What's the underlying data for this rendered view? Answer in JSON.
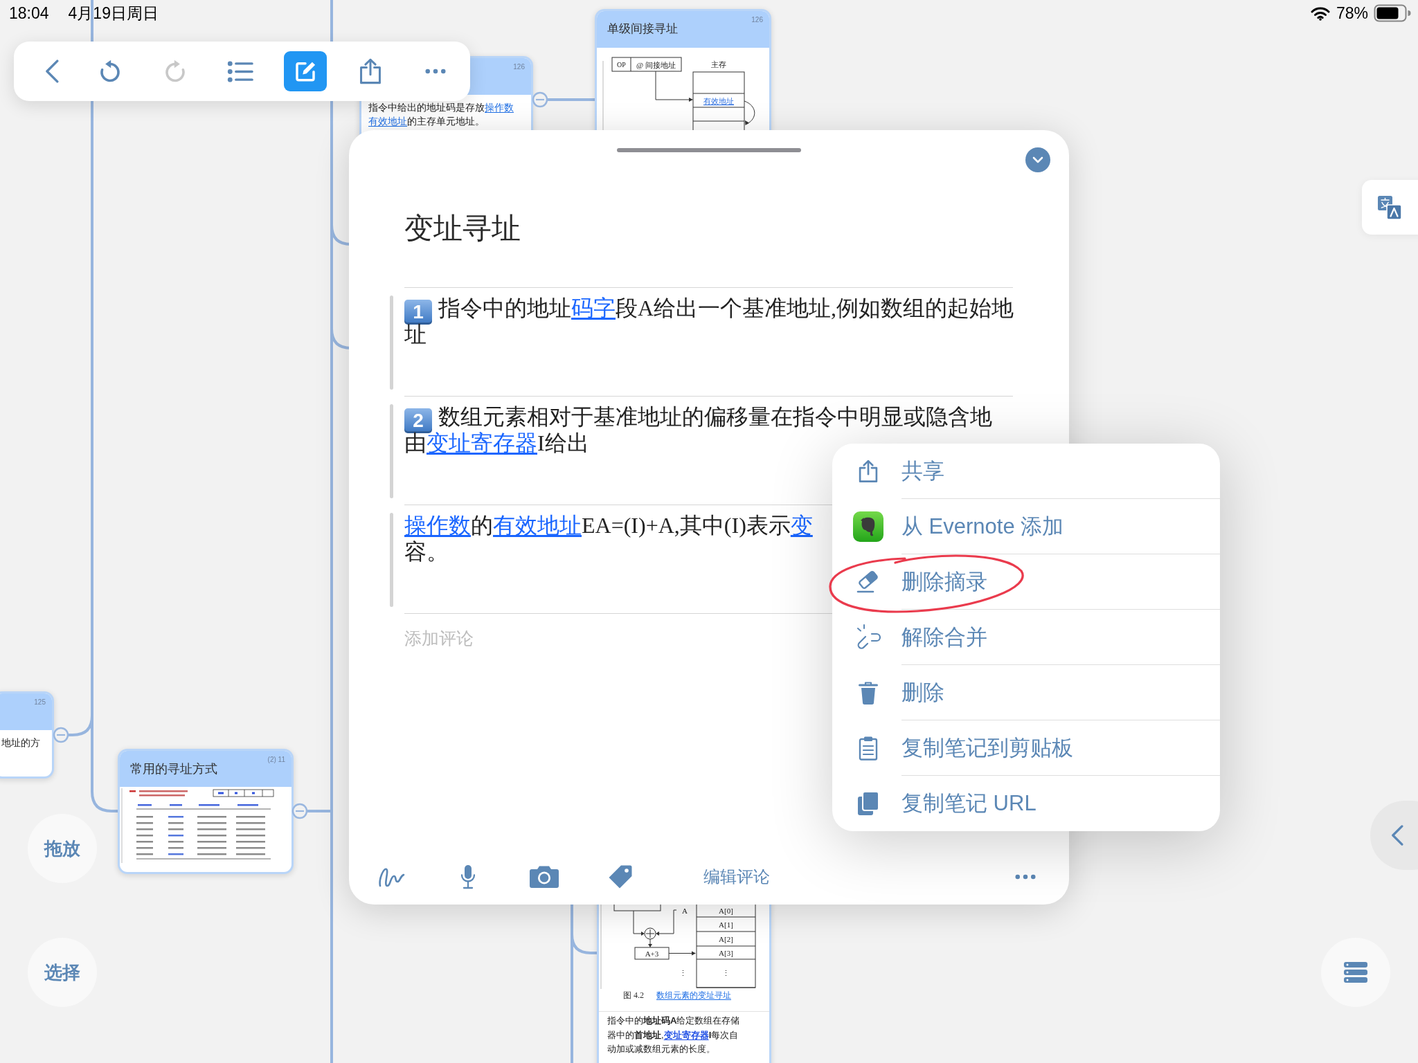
{
  "status_bar": {
    "time": "18:04",
    "date": "4月19日周日",
    "battery": "78%"
  },
  "toolbar": {
    "buttons": [
      {
        "kind": "back",
        "active": false,
        "disabled": false
      },
      {
        "kind": "undo",
        "active": false,
        "disabled": false
      },
      {
        "kind": "redo",
        "active": false,
        "disabled": true
      },
      {
        "kind": "outline",
        "active": false,
        "disabled": false
      },
      {
        "kind": "edit",
        "active": true,
        "disabled": false
      },
      {
        "kind": "share",
        "active": false,
        "disabled": false
      },
      {
        "kind": "more",
        "active": false,
        "disabled": false
      }
    ]
  },
  "mind_map": {
    "cards": [
      {
        "kind": "text",
        "page": "126",
        "lines": [
          [
            {
              "text": "指令中给出的地址码是存放"
            },
            {
              "kind": "link",
              "text": "操作数"
            }
          ],
          [
            {
              "kind": "link",
              "text": "有效地址"
            },
            {
              "text": "的主存单元地址。"
            }
          ]
        ]
      },
      {
        "kind": "indirect_diagram",
        "title": "单级间接寻址",
        "page": "126",
        "diagram": {
          "opcode": "OP",
          "address": "@ 间接地址",
          "memory": "主存",
          "target": "有效地址"
        }
      },
      {
        "kind": "text",
        "page": "125",
        "lines": [
          [
            {
              "text": "地址的方"
            }
          ]
        ]
      },
      {
        "kind": "table_image",
        "title": "常用的寻址方式",
        "page": "(2) 11"
      },
      {
        "kind": "array_diagram",
        "diagram": {
          "base": "A",
          "register": "A+3",
          "cells": [
            "A[0]",
            "A[1]",
            "A[2]",
            "A[3]",
            "⋮"
          ],
          "ellipsis": "⋮"
        },
        "caption": {
          "number": "图 4.2",
          "link": "数组元素的变址寻址"
        },
        "lines": [
          [
            {
              "text": "指令中的**地址码A**给定数组在存储"
            }
          ],
          [
            {
              "text": "器中的**首地址**,"
            },
            {
              "kind": "link",
              "text": "**变址寄存器**"
            },
            {
              "text": "**I**每次自"
            }
          ],
          [
            {
              "text": "动加或减数组元素的长度。"
            }
          ]
        ]
      }
    ]
  },
  "side_buttons": [
    {
      "label": "拖放"
    },
    {
      "label": "选择"
    }
  ],
  "note": {
    "title": "变址寻址",
    "excerpts": [
      {
        "number": "1",
        "lines": [
          [
            {
              "text": "指令中的地址"
            },
            {
              "kind": "link",
              "text": "码字"
            },
            {
              "text": "段A给出一个基准地址,例如数组的起始地"
            }
          ],
          [
            {
              "text": "址"
            }
          ]
        ]
      },
      {
        "number": "2",
        "lines": [
          [
            {
              "text": "数组元素相对于基准地址的偏移量在指令中明显或隐含地"
            }
          ],
          [
            {
              "text": "由"
            },
            {
              "kind": "link",
              "text": "变址寄存器"
            },
            {
              "text": "I给出"
            }
          ]
        ]
      },
      {
        "lines": [
          [
            {
              "kind": "link",
              "text": "操作数"
            },
            {
              "text": "的"
            },
            {
              "kind": "link",
              "text": "有效地址"
            },
            {
              "text": "EA=(I)+A,其中(I)表示"
            },
            {
              "kind": "link",
              "text": "变"
            }
          ],
          [
            {
              "text": "容。"
            }
          ]
        ]
      }
    ],
    "comment": {
      "placeholder": "添加评论"
    },
    "actions": [
      {
        "kind": "draw"
      },
      {
        "kind": "voice"
      },
      {
        "kind": "camera"
      },
      {
        "kind": "tag"
      },
      {
        "kind": "text",
        "label": "编辑评论"
      },
      {
        "kind": "more"
      }
    ]
  },
  "menu": {
    "items": [
      {
        "kind": "share",
        "label": "共享",
        "circled": false
      },
      {
        "kind": "evernote",
        "label": "从 Evernote 添加",
        "circled": false
      },
      {
        "kind": "eraser",
        "label": "删除摘录",
        "circled": true
      },
      {
        "kind": "unlink",
        "label": "解除合并",
        "circled": false
      },
      {
        "kind": "trash",
        "label": "删除",
        "circled": false
      },
      {
        "kind": "clipboard",
        "label": "复制笔记到剪贴板",
        "circled": false
      },
      {
        "kind": "copy",
        "label": "复制笔记 URL",
        "circled": false
      }
    ]
  }
}
